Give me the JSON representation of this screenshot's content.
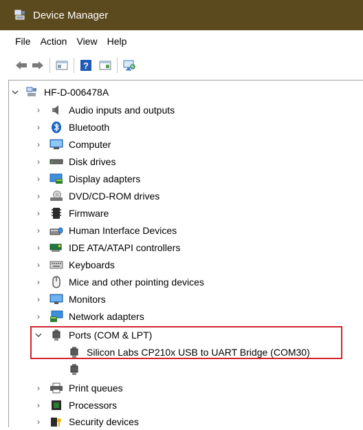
{
  "window": {
    "title": "Device Manager"
  },
  "menu": [
    "File",
    "Action",
    "View",
    "Help"
  ],
  "toolbar": {
    "icons": [
      "back-arrow-icon",
      "forward-arrow-icon",
      "properties-icon",
      "help-icon",
      "update-driver-icon",
      "scan-hardware-icon"
    ]
  },
  "tree": {
    "root": {
      "label": "HF-D-006478A",
      "expanded": true
    },
    "categories": [
      {
        "label": "Audio inputs and outputs",
        "icon": "speaker-icon"
      },
      {
        "label": "Bluetooth",
        "icon": "bluetooth-icon"
      },
      {
        "label": "Computer",
        "icon": "computer-icon"
      },
      {
        "label": "Disk drives",
        "icon": "disk-drive-icon"
      },
      {
        "label": "Display adapters",
        "icon": "display-adapter-icon"
      },
      {
        "label": "DVD/CD-ROM drives",
        "icon": "dvd-drive-icon"
      },
      {
        "label": "Firmware",
        "icon": "firmware-icon"
      },
      {
        "label": "Human Interface Devices",
        "icon": "hid-icon"
      },
      {
        "label": "IDE ATA/ATAPI controllers",
        "icon": "ide-controller-icon"
      },
      {
        "label": "Keyboards",
        "icon": "keyboard-icon"
      },
      {
        "label": "Mice and other pointing devices",
        "icon": "mouse-icon"
      },
      {
        "label": "Monitors",
        "icon": "monitor-icon"
      },
      {
        "label": "Network adapters",
        "icon": "network-adapter-icon"
      }
    ],
    "ports": {
      "label": "Ports (COM & LPT)",
      "expanded": true,
      "children": [
        {
          "label": "Silicon Labs CP210x USB to UART Bridge (COM30)"
        },
        {
          "label": ""
        }
      ]
    },
    "after": [
      {
        "label": "Print queues",
        "icon": "printer-icon"
      },
      {
        "label": "Processors",
        "icon": "processor-icon"
      },
      {
        "label": "Security devices",
        "icon": "security-icon"
      }
    ]
  },
  "colors": {
    "titlebar": "#5c4a1f",
    "highlight_border": "#d1222e"
  }
}
